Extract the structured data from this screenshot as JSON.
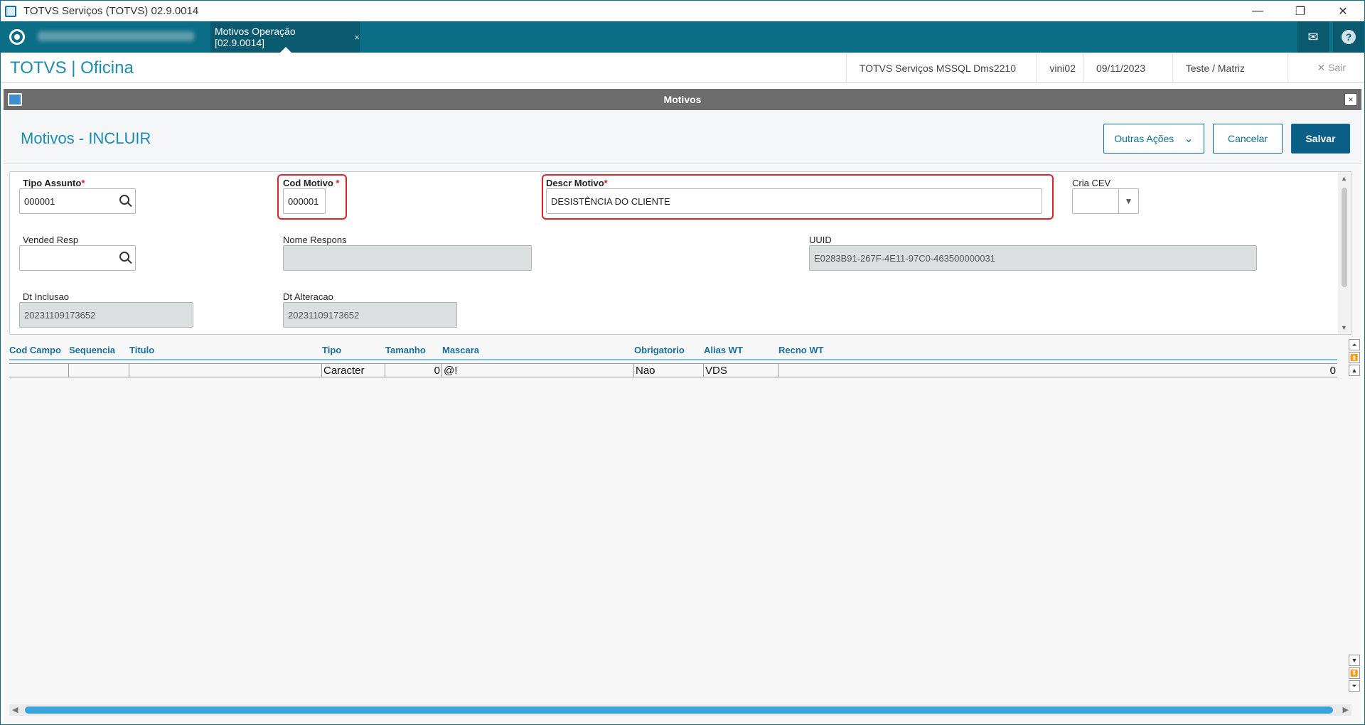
{
  "window": {
    "title": "TOTVS Serviços (TOTVS) 02.9.0014",
    "minimize": "—",
    "restore": "❐",
    "close": "✕"
  },
  "appbar": {
    "active_tab": "Motivos Operação [02.9.0014]",
    "tab_close": "×",
    "mail_icon": "✉",
    "help_icon": "?"
  },
  "module": {
    "title": "TOTVS | Oficina",
    "environment": "TOTVS Serviços MSSQL Dms2210",
    "user": "vini02",
    "date": "09/11/2023",
    "branch": "Teste / Matriz",
    "exit_label": "✕  Sair"
  },
  "dialog": {
    "title": "Motivos",
    "close": "×",
    "operation_title": "Motivos - INCLUIR",
    "buttons": {
      "more_actions": "Outras Ações",
      "more_actions_chevron": "⌄",
      "cancel": "Cancelar",
      "save": "Salvar"
    }
  },
  "form": {
    "tipo_assunto": {
      "label": "Tipo Assunto",
      "required": "*",
      "value": "000001"
    },
    "cod_motivo": {
      "label": "Cod Motivo",
      "required": "*",
      "value": "000001"
    },
    "descr_motivo": {
      "label": "Descr Motivo",
      "required": "*",
      "value": "DESISTÊNCIA DO CLIENTE"
    },
    "cria_cev": {
      "label": "Cria CEV",
      "value": "",
      "arrow": "▼"
    },
    "vended_resp": {
      "label": "Vended Resp",
      "value": ""
    },
    "nome_respons": {
      "label": "Nome Respons",
      "value": ""
    },
    "uuid": {
      "label": "UUID",
      "value": "E0283B91-267F-4E11-97C0-463500000031"
    },
    "dt_inclusao": {
      "label": "Dt Inclusao",
      "value": "20231109173652"
    },
    "dt_alteracao": {
      "label": "Dt Alteracao",
      "value": "20231109173652"
    }
  },
  "grid": {
    "columns": [
      "Cod Campo",
      "Sequencia",
      "Titulo",
      "Tipo",
      "Tamanho",
      "Mascara",
      "Obrigatorio",
      "Alias WT",
      "Recno WT"
    ],
    "rows": [
      [
        "",
        "",
        "",
        "Caracter",
        "0",
        "@!",
        "Nao",
        "VDS",
        "0"
      ]
    ]
  },
  "colors": {
    "brand_teal": "#0b6e86",
    "title_blue": "#1b8bb0",
    "primary_button": "#0b5f86",
    "highlight_red": "#e0202a"
  }
}
